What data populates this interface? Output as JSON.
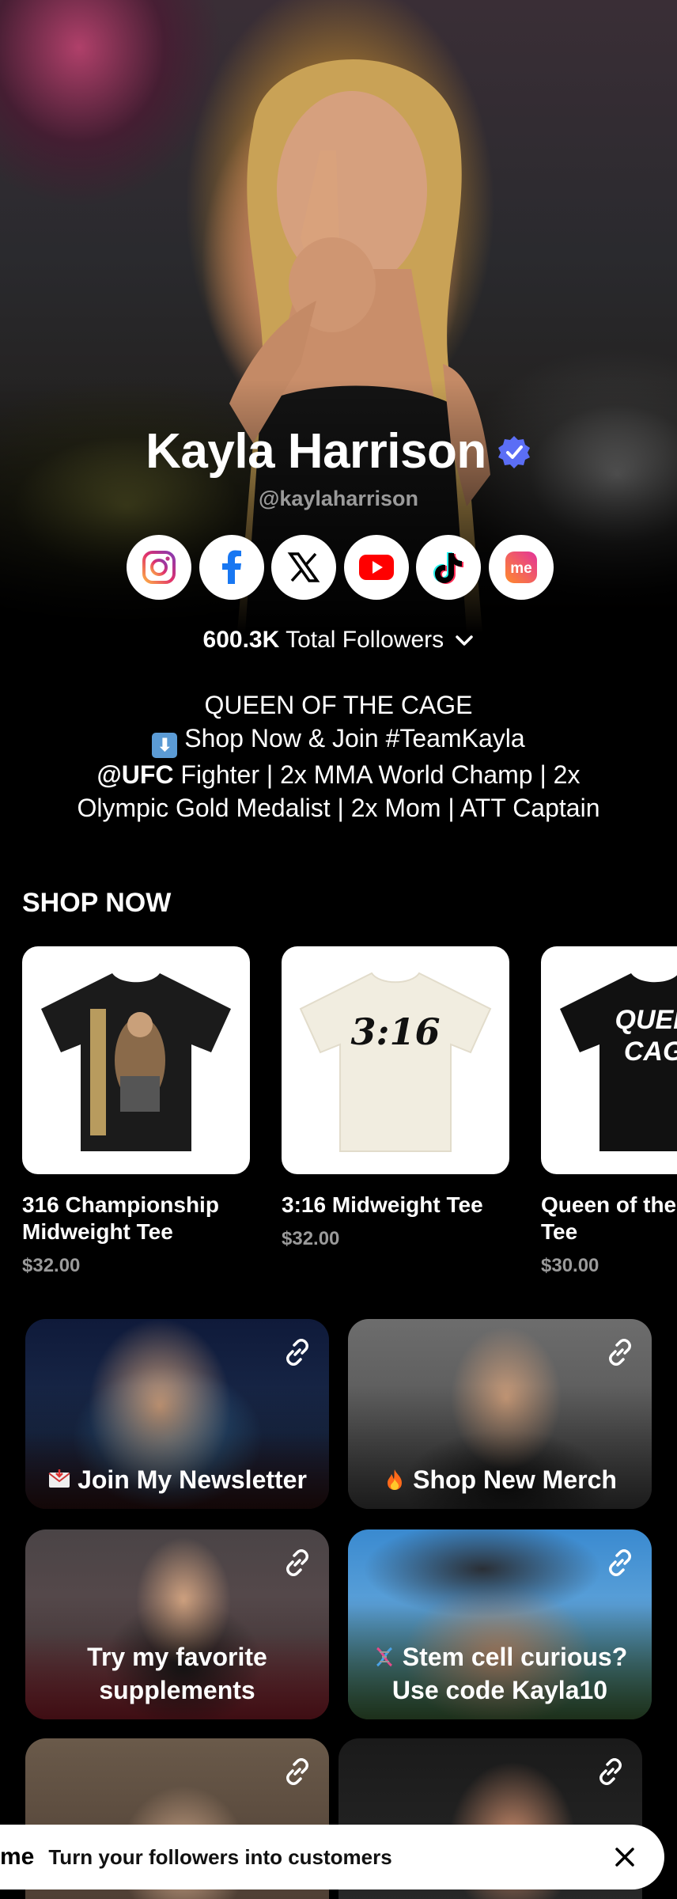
{
  "profile": {
    "name": "Kayla Harrison",
    "handle": "@kaylaharrison",
    "verified": true,
    "followers_count": "600.3K",
    "followers_label": "Total Followers",
    "bio_line1": "QUEEN OF THE CAGE",
    "bio_line2": "Shop Now & Join #TeamKayla",
    "bio_line3_bold": "@UFC",
    "bio_line3": " Fighter | 2x MMA World Champ | 2x",
    "bio_line4": "Olympic Gold Medalist | 2x Mom | ATT Captain"
  },
  "socials": [
    {
      "icon": "instagram-icon",
      "color": "#d6249f"
    },
    {
      "icon": "facebook-icon",
      "color": "#1877f2"
    },
    {
      "icon": "x-icon",
      "color": "#000000"
    },
    {
      "icon": "youtube-icon",
      "color": "#ff0000"
    },
    {
      "icon": "tiktok-icon",
      "color": "#000000"
    },
    {
      "icon": "linkme-icon",
      "color": "#ff5a3c"
    }
  ],
  "shop": {
    "title": "SHOP NOW",
    "products": [
      {
        "name": "316 Championship Midweight Tee",
        "price": "$32.00",
        "shirt_color": "#1b1b1b"
      },
      {
        "name": "3:16 Midweight Tee",
        "price": "$32.00",
        "shirt_color": "#f4f1e6"
      },
      {
        "name": "Queen of the Cage Tee",
        "price": "$30.00",
        "shirt_color": "#111111"
      }
    ]
  },
  "links": [
    {
      "label": "Join My Newsletter",
      "emoji": "envelope-icon"
    },
    {
      "label": "Shop New Merch",
      "emoji": "fire-icon"
    },
    {
      "label": "Try my favorite supplements",
      "emoji": ""
    },
    {
      "label": "Stem cell curious? Use code Kayla10",
      "emoji": "dna-icon"
    }
  ],
  "banner": {
    "logo": "me",
    "text": "Turn your followers into customers"
  },
  "colors": {
    "verified": "#5b6ef5",
    "background": "#000000",
    "muted_text": "#9a9a9a"
  }
}
